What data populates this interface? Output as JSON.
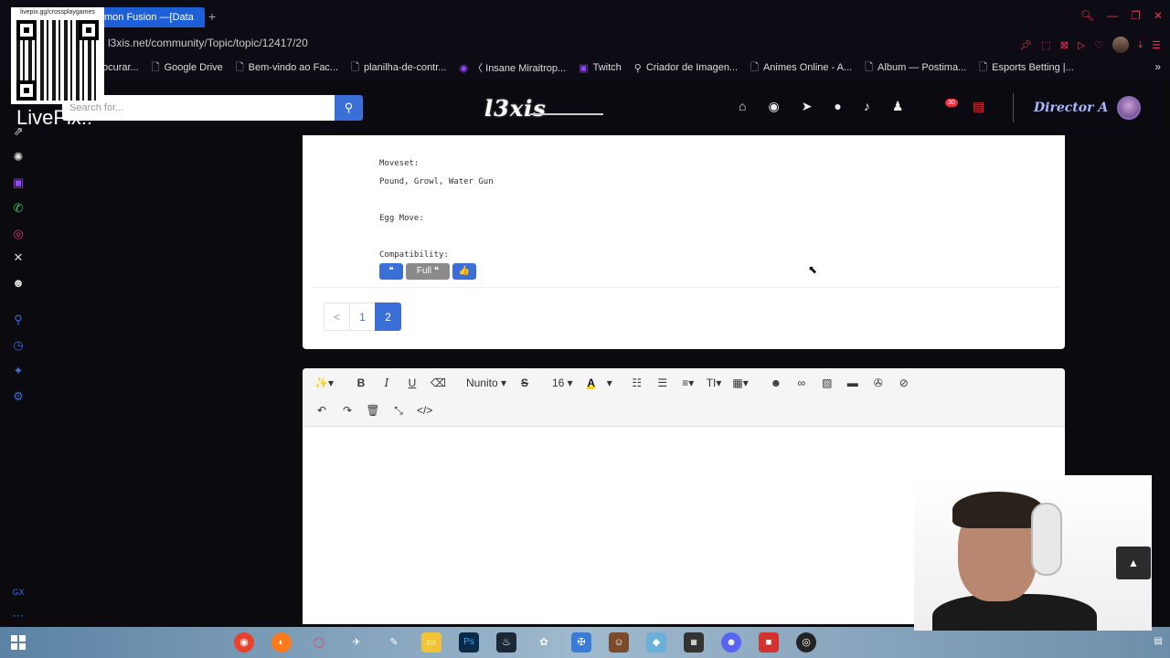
{
  "browser": {
    "tab_title": "mon Fusion —[Data",
    "new_tab": "+",
    "url": "l3xis.net/community/Topic/topic/12417/20",
    "bookmarks": [
      {
        "label": "ocurar...",
        "icon": "folder"
      },
      {
        "label": "Google Drive",
        "icon": "page"
      },
      {
        "label": "Bem-vindo ao Fac...",
        "icon": "page"
      },
      {
        "label": "planilha-de-contr...",
        "icon": "page"
      },
      {
        "label": "〈 Insane Miraitrop...",
        "icon": "globe"
      },
      {
        "label": "Twitch",
        "icon": "twitch"
      },
      {
        "label": "Criador de Imagen...",
        "icon": "search"
      },
      {
        "label": "Animes Online - A...",
        "icon": "page"
      },
      {
        "label": "Album — Postima...",
        "icon": "page"
      },
      {
        "label": "Esports Betting |...",
        "icon": "page"
      }
    ],
    "more": "»"
  },
  "overlay": {
    "qr_caption": "livepix.gg/crossplaygames",
    "livepix_text": "LivePix!!"
  },
  "site": {
    "search_placeholder": "Search for...",
    "logo": "l3xis",
    "notification_badge": "30",
    "username": "Director A"
  },
  "post": {
    "moveset_label": "Moveset:",
    "moveset_value": "Pound, Growl, Water Gun",
    "egg_move_label": "Egg Move:",
    "compatibility_label": "Compatibility:",
    "quote_btn": "❝",
    "full_quote_btn": "Full ❝",
    "like_btn": "👍"
  },
  "pagination": {
    "prev": "<",
    "pages": [
      "1",
      "2"
    ],
    "active": "2"
  },
  "editor": {
    "font_name": "Nunito",
    "font_size": "16"
  },
  "colors": {
    "accent": "#3b6fd8",
    "browser_accent": "#e33a5a"
  }
}
